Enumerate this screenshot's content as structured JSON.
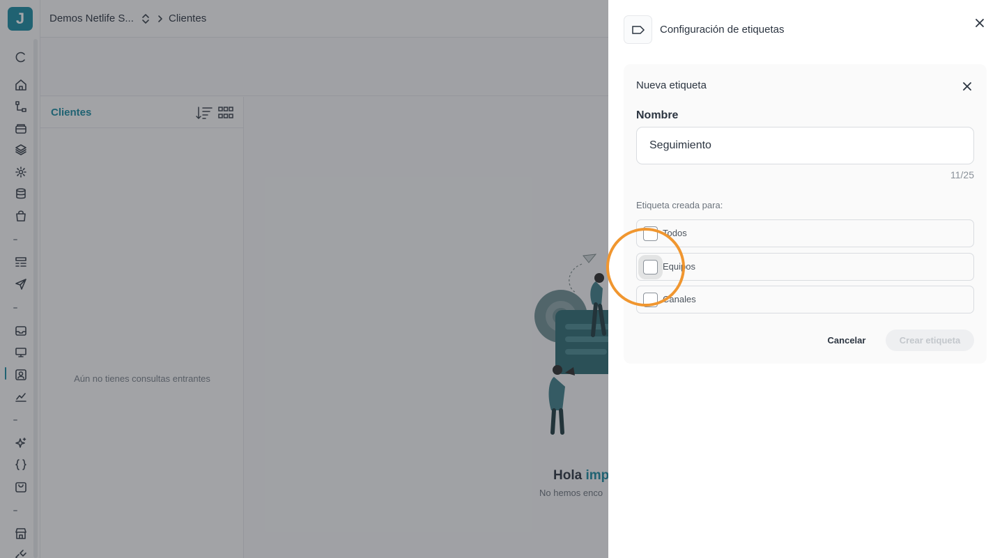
{
  "app": {
    "logo_letter": "J"
  },
  "topbar": {
    "workspace": "Demos Netlife S...",
    "breadcrumb_current": "Clientes"
  },
  "list": {
    "title": "Clientes",
    "empty_text": "Aún no tienes consultas entrantes"
  },
  "main": {
    "hello_prefix": "Hola",
    "hello_name": "impo",
    "subtitle": "No hemos enco"
  },
  "drawer": {
    "title": "Configuración de etiquetas",
    "icon": "tag-icon"
  },
  "form": {
    "card_title": "Nueva etiqueta",
    "name_label": "Nombre",
    "name_value": "Seguimiento",
    "counter": "11/25",
    "for_label": "Etiqueta creada para:",
    "options": [
      {
        "label": "Todos",
        "checked": false
      },
      {
        "label": "Equipos",
        "checked": false
      },
      {
        "label": "Canales",
        "checked": false
      }
    ],
    "cancel_label": "Cancelar",
    "create_label": "Crear etiqueta"
  },
  "colors": {
    "accent": "#1a8aa0",
    "highlight": "#f0962f"
  }
}
